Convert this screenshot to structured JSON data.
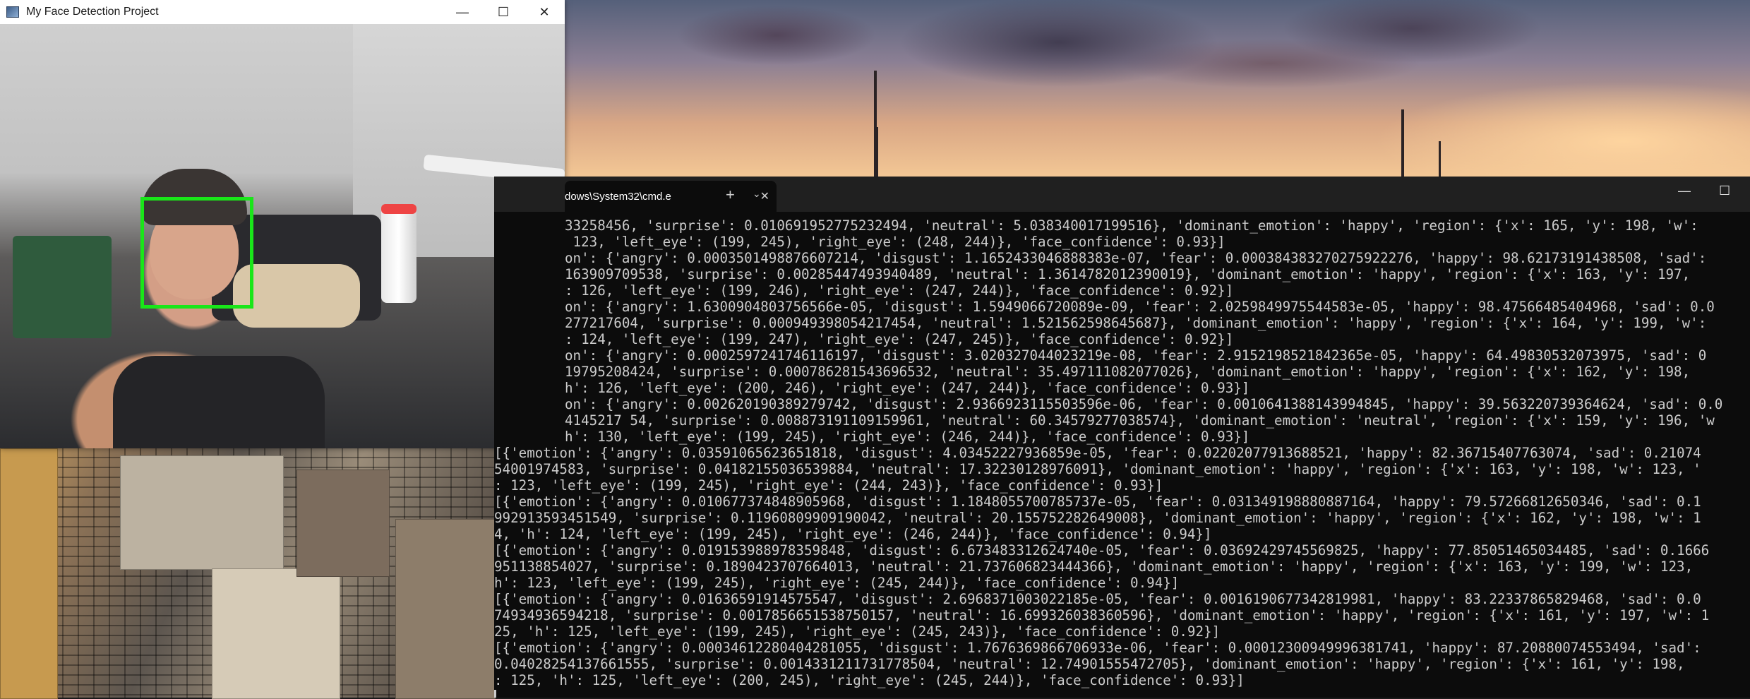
{
  "camera_window": {
    "title": "My Face Detection Project",
    "controls": {
      "minimize": "—",
      "maximize": "☐",
      "close": "✕"
    },
    "box_color": "#19e619"
  },
  "terminal": {
    "tab_title": "dows\\System32\\cmd.e",
    "tab_close": "✕",
    "new_tab": "+",
    "dropdown": "⌄",
    "controls": {
      "minimize": "—",
      "maximize": "☐"
    },
    "lines": [
      "33258456, 'surprise': 0.010691952775232494, 'neutral': 5.038340017199516}, 'dominant_emotion': 'happy', 'region': {'x': 165, 'y': 198, 'w':",
      " 123, 'left_eye': (199, 245), 'right_eye': (248, 244)}, 'face_confidence': 0.93}]",
      "on': {'angry': 0.0003501498876607214, 'disgust': 1.1652433046888383e-07, 'fear': 0.000384383270275922276, 'happy': 98.62173191438508, 'sad':",
      "163909709538, 'surprise': 0.00285447493940489, 'neutral': 1.3614782012390019}, 'dominant_emotion': 'happy', 'region': {'x': 163, 'y': 197,",
      ": 126, 'left_eye': (199, 246), 'right_eye': (247, 244)}, 'face_confidence': 0.92}]",
      "on': {'angry': 1.6300904803756566e-05, 'disgust': 1.5949066720089e-09, 'fear': 2.0259849975544583e-05, 'happy': 98.47566485404968, 'sad': 0.0",
      "277217604, 'surprise': 0.000949398054217454, 'neutral': 1.521562598645687}, 'dominant_emotion': 'happy', 'region': {'x': 164, 'y': 199, 'w':",
      ": 124, 'left_eye': (199, 247), 'right_eye': (247, 245)}, 'face_confidence': 0.92}]",
      "on': {'angry': 0.0002597241746116197, 'disgust': 3.020327044023219e-08, 'fear': 2.9152198521842365e-05, 'happy': 64.49830532073975, 'sad': 0",
      "19795208424, 'surprise': 0.000786281543696532, 'neutral': 35.497111082077026}, 'dominant_emotion': 'happy', 'region': {'x': 162, 'y': 198,",
      "h': 126, 'left_eye': (200, 246), 'right_eye': (247, 244)}, 'face_confidence': 0.93}]",
      "on': {'angry': 0.002620190389279742, 'disgust': 2.9366923115503596e-06, 'fear': 0.0010641388143994845, 'happy': 39.563220739364624, 'sad': 0.0",
      "4145217 54, 'surprise': 0.008873191109159961, 'neutral': 60.34579277038574}, 'dominant_emotion': 'neutral', 'region': {'x': 159, 'y': 196, 'w",
      "h': 130, 'left_eye': (199, 245), 'right_eye': (246, 244)}, 'face_confidence': 0.93}]",
      "[{'emotion': {'angry': 0.03591065623651818, 'disgust': 4.03452227936859e-05, 'fear': 0.02202077913688521, 'happy': 82.36715407763074, 'sad': 0.21074",
      "54001974583, 'surprise': 0.04182155036539884, 'neutral': 17.32230128976091}, 'dominant_emotion': 'happy', 'region': {'x': 163, 'y': 198, 'w': 123, '",
      ": 123, 'left_eye': (199, 245), 'right_eye': (244, 243)}, 'face_confidence': 0.93}]",
      "[{'emotion': {'angry': 0.010677374848905968, 'disgust': 1.1848055700785737e-05, 'fear': 0.031349198880887164, 'happy': 79.57266812650346, 'sad': 0.1",
      "992913593451549, 'surprise': 0.11960809909190042, 'neutral': 20.155752282649008}, 'dominant_emotion': 'happy', 'region': {'x': 162, 'y': 198, 'w': 1",
      "4, 'h': 124, 'left_eye': (199, 245), 'right_eye': (246, 244)}, 'face_confidence': 0.94}]",
      "[{'emotion': {'angry': 0.019153988978359848, 'disgust': 6.673483312624740e-05, 'fear': 0.03692429745569825, 'happy': 77.85051465034485, 'sad': 0.1666",
      "951138854027, 'surprise': 0.1890423707664013, 'neutral': 21.737606823444366}, 'dominant_emotion': 'happy', 'region': {'x': 163, 'y': 199, 'w': 123,",
      "h': 123, 'left_eye': (199, 245), 'right_eye': (245, 244)}, 'face_confidence': 0.94}]",
      "[{'emotion': {'angry': 0.01636591914575547, 'disgust': 2.6968371003022185e-05, 'fear': 0.0016190677342819981, 'happy': 83.22337865829468, 'sad': 0.0",
      "74934936594218, 'surprise': 0.0017856651538750157, 'neutral': 16.699326038360596}, 'dominant_emotion': 'happy', 'region': {'x': 161, 'y': 197, 'w': 1",
      "25, 'h': 125, 'left_eye': (199, 245), 'right_eye': (245, 243)}, 'face_confidence': 0.92}]",
      "[{'emotion': {'angry': 0.00034612280404281055, 'disgust': 1.7676369866706933e-06, 'fear': 0.00012300949996381741, 'happy': 87.20880074553494, 'sad':",
      "0.04028254137661555, 'surprise': 0.0014331211731778504, 'neutral': 12.74901555472705}, 'dominant_emotion': 'happy', 'region': {'x': 161, 'y': 198,",
      ": 125, 'h': 125, 'left_eye': (200, 245), 'right_eye': (245, 244)}, 'face_confidence': 0.93}]"
    ]
  }
}
